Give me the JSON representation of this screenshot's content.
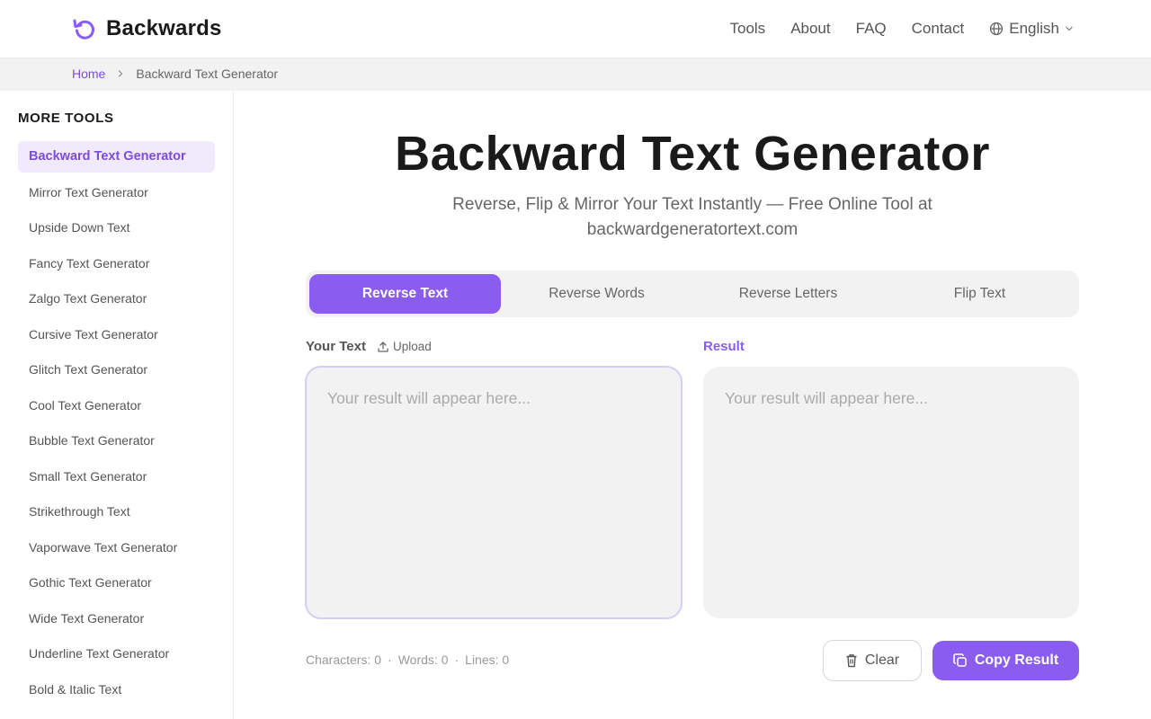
{
  "header": {
    "logo_text": "Backwards",
    "nav": [
      "Tools",
      "About",
      "FAQ",
      "Contact"
    ],
    "language": "English"
  },
  "breadcrumb": {
    "home": "Home",
    "current": "Backward Text Generator"
  },
  "sidebar": {
    "title": "MORE TOOLS",
    "items": [
      {
        "label": "Backward Text Generator",
        "active": true
      },
      {
        "label": "Mirror Text Generator"
      },
      {
        "label": "Upside Down Text"
      },
      {
        "label": "Fancy Text Generator"
      },
      {
        "label": "Zalgo Text Generator"
      },
      {
        "label": "Cursive Text Generator"
      },
      {
        "label": "Glitch Text Generator"
      },
      {
        "label": "Cool Text Generator"
      },
      {
        "label": "Bubble Text Generator"
      },
      {
        "label": "Small Text Generator"
      },
      {
        "label": "Strikethrough Text"
      },
      {
        "label": "Vaporwave Text Generator"
      },
      {
        "label": "Gothic Text Generator"
      },
      {
        "label": "Wide Text Generator"
      },
      {
        "label": "Underline Text Generator"
      },
      {
        "label": "Bold & Italic Text"
      }
    ]
  },
  "main": {
    "title": "Backward Text Generator",
    "subtitle": "Reverse, Flip & Mirror Your Text Instantly — Free Online Tool at backwardgeneratortext.com",
    "tabs": [
      {
        "label": "Reverse Text",
        "active": true
      },
      {
        "label": "Reverse Words"
      },
      {
        "label": "Reverse Letters"
      },
      {
        "label": "Flip Text"
      }
    ],
    "input_label": "Your Text",
    "upload_label": "Upload",
    "result_label": "Result",
    "input_placeholder": "Your result will appear here...",
    "input_value": "",
    "result_placeholder": "Your result will appear here...",
    "stats": {
      "characters": "Characters: 0",
      "words": "Words: 0",
      "lines": "Lines: 0",
      "separator": "·"
    },
    "clear_label": "Clear",
    "copy_label": "Copy Result"
  },
  "colors": {
    "accent": "#8a5cf0",
    "accent_text": "#7c4ddb",
    "active_bg": "#f1eafd",
    "panel_bg": "#f2f2f2"
  }
}
